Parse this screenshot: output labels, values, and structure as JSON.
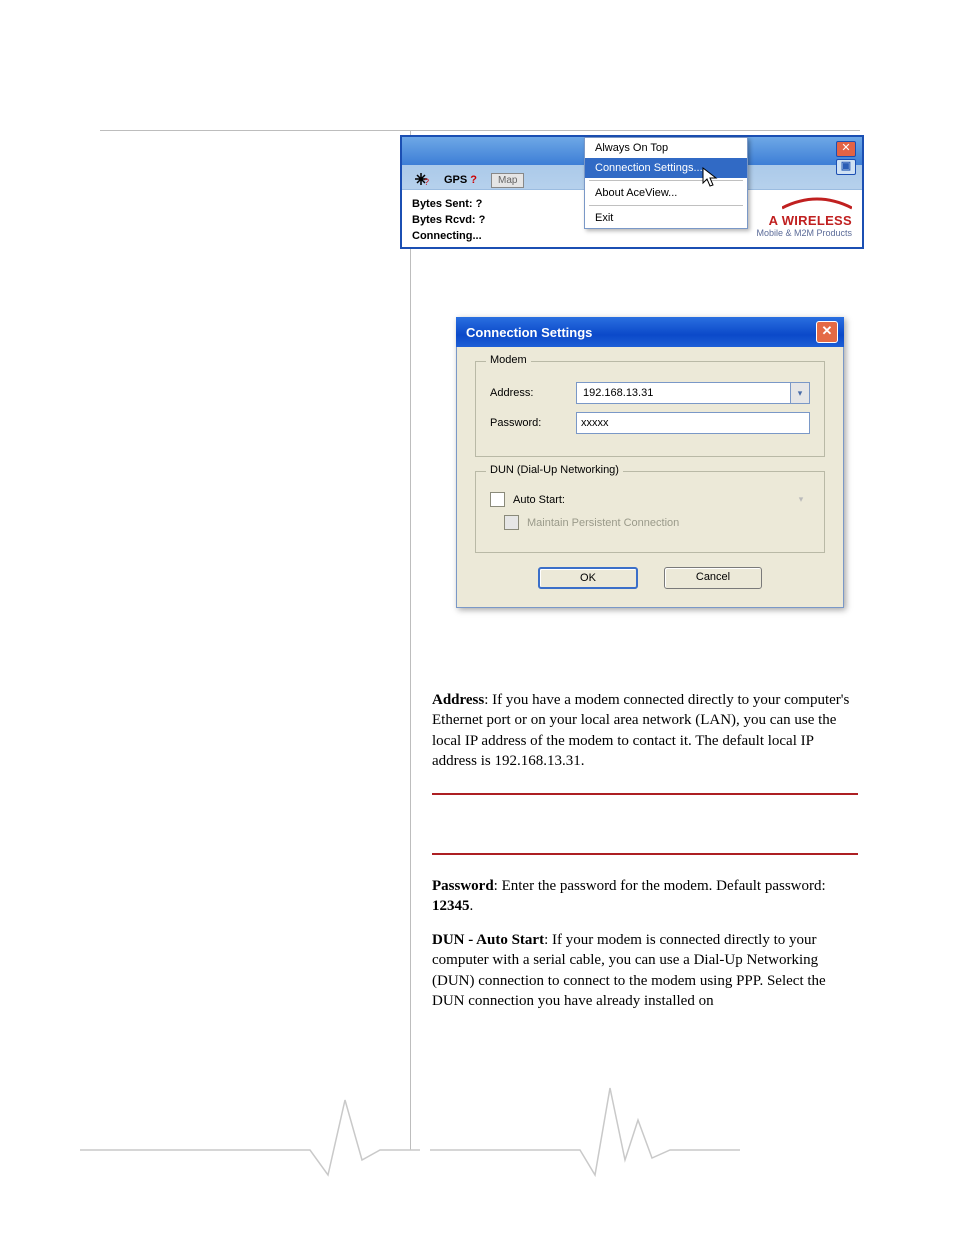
{
  "aceview": {
    "gps_label": "GPS",
    "gps_mark": "?",
    "map_button": "Map",
    "menu": {
      "always_on_top": "Always On Top",
      "connection_settings": "Connection Settings...",
      "about": "About AceView...",
      "exit": "Exit"
    },
    "stats": {
      "bytes_sent_label": "Bytes Sent: ",
      "bytes_sent_value": "?",
      "bytes_rcvd_label": "Bytes Rcvd: ",
      "bytes_rcvd_value": "?",
      "connecting": "Connecting..."
    },
    "brand_line1": "A WIRELESS",
    "brand_line2": "Mobile & M2M Products"
  },
  "dialog": {
    "title": "Connection Settings",
    "modem_legend": "Modem",
    "address_label": "Address:",
    "address_value": "192.168.13.31",
    "password_label": "Password:",
    "password_value": "xxxxx",
    "dun_legend": "DUN (Dial-Up Networking)",
    "auto_start_label": "Auto Start:",
    "maintain_label": "Maintain Persistent Connection",
    "ok": "OK",
    "cancel": "Cancel"
  },
  "prose": {
    "p1_bold": "Address",
    "p1_rest": ": If you have a modem connected directly to your computer's Ethernet port or on your local area network (LAN), you can use the local IP address of the modem to contact it. The default local IP address is 192.168.13.31.",
    "p2_bold": "Password",
    "p2_rest_a": ": Enter the password for the modem.  Default password: ",
    "p2_rest_b": "12345",
    "p2_rest_c": ".",
    "p3_bold": "DUN - Auto Start",
    "p3_rest": ": If your modem is connected directly to your computer with a serial cable, you can use a Dial-Up Networking (DUN) connection to connect to the modem using PPP.  Select the DUN connection you have already installed on"
  }
}
